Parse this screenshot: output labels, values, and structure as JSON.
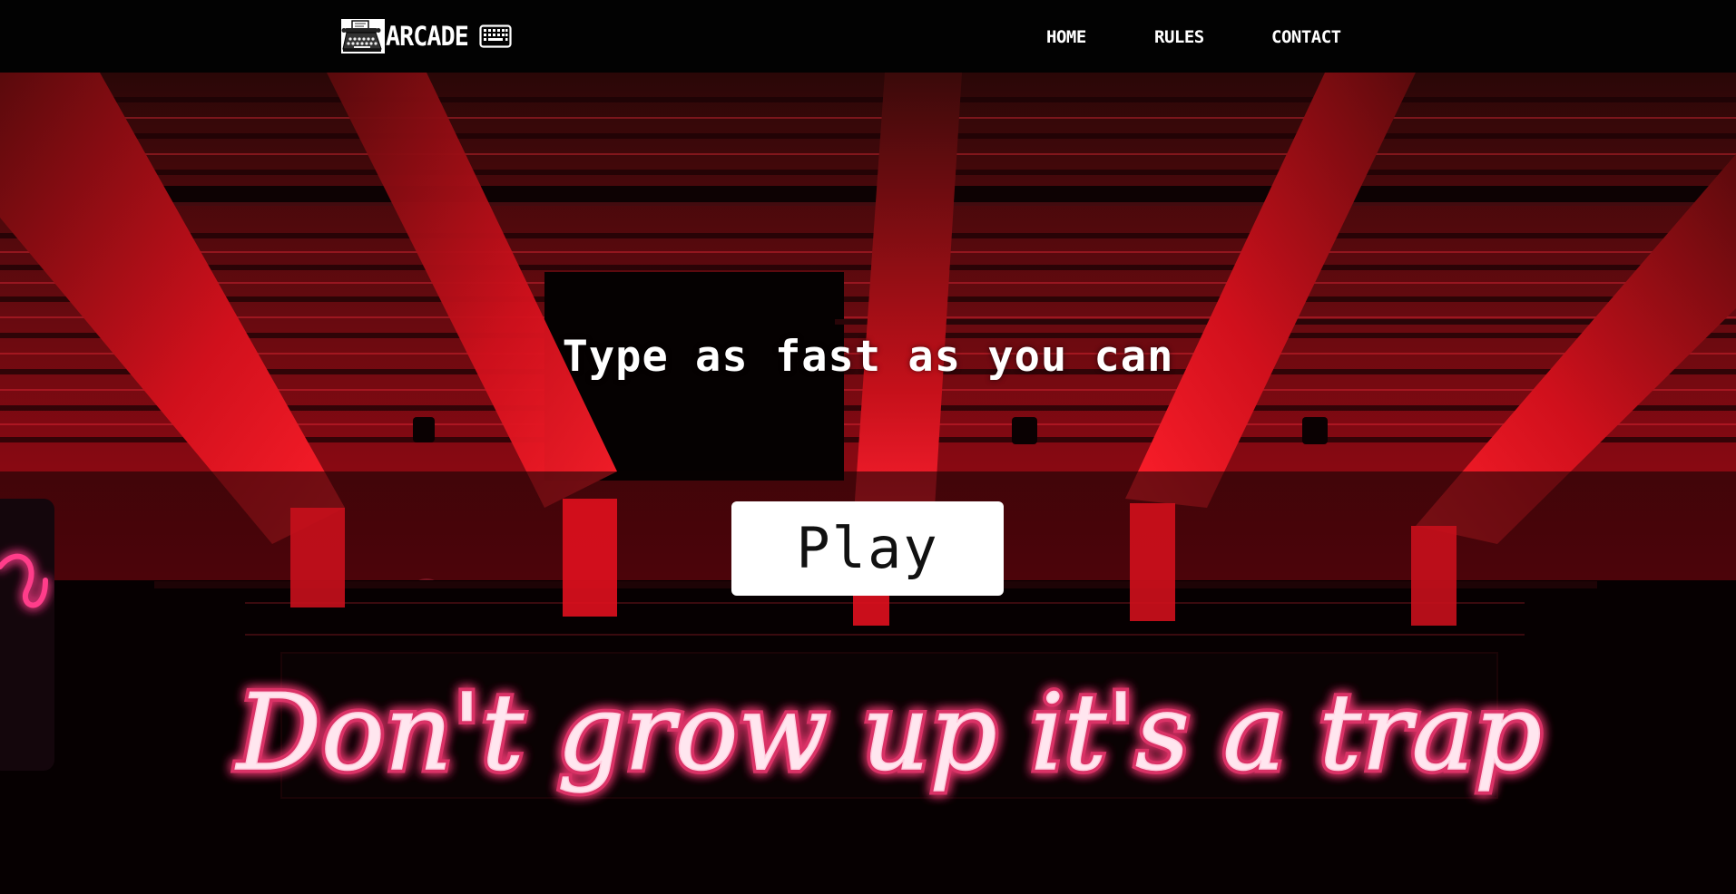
{
  "brand": {
    "name": "ARCADE",
    "logo_icon": "typewriter-icon",
    "trailing_icon": "keyboard-icon"
  },
  "nav": {
    "items": [
      {
        "label": "HOME"
      },
      {
        "label": "RULES"
      },
      {
        "label": "CONTACT"
      }
    ]
  },
  "hero": {
    "tagline": "Type as fast as you can",
    "play_label": "Play",
    "neon_sign_text": "Don't grow up it's a trap"
  },
  "colors": {
    "navbar_bg": "#020202",
    "neon_pink": "#ff2a6d",
    "beam_red": "#e0001a",
    "button_bg": "#ffffff",
    "text_light": "#ffffff"
  }
}
